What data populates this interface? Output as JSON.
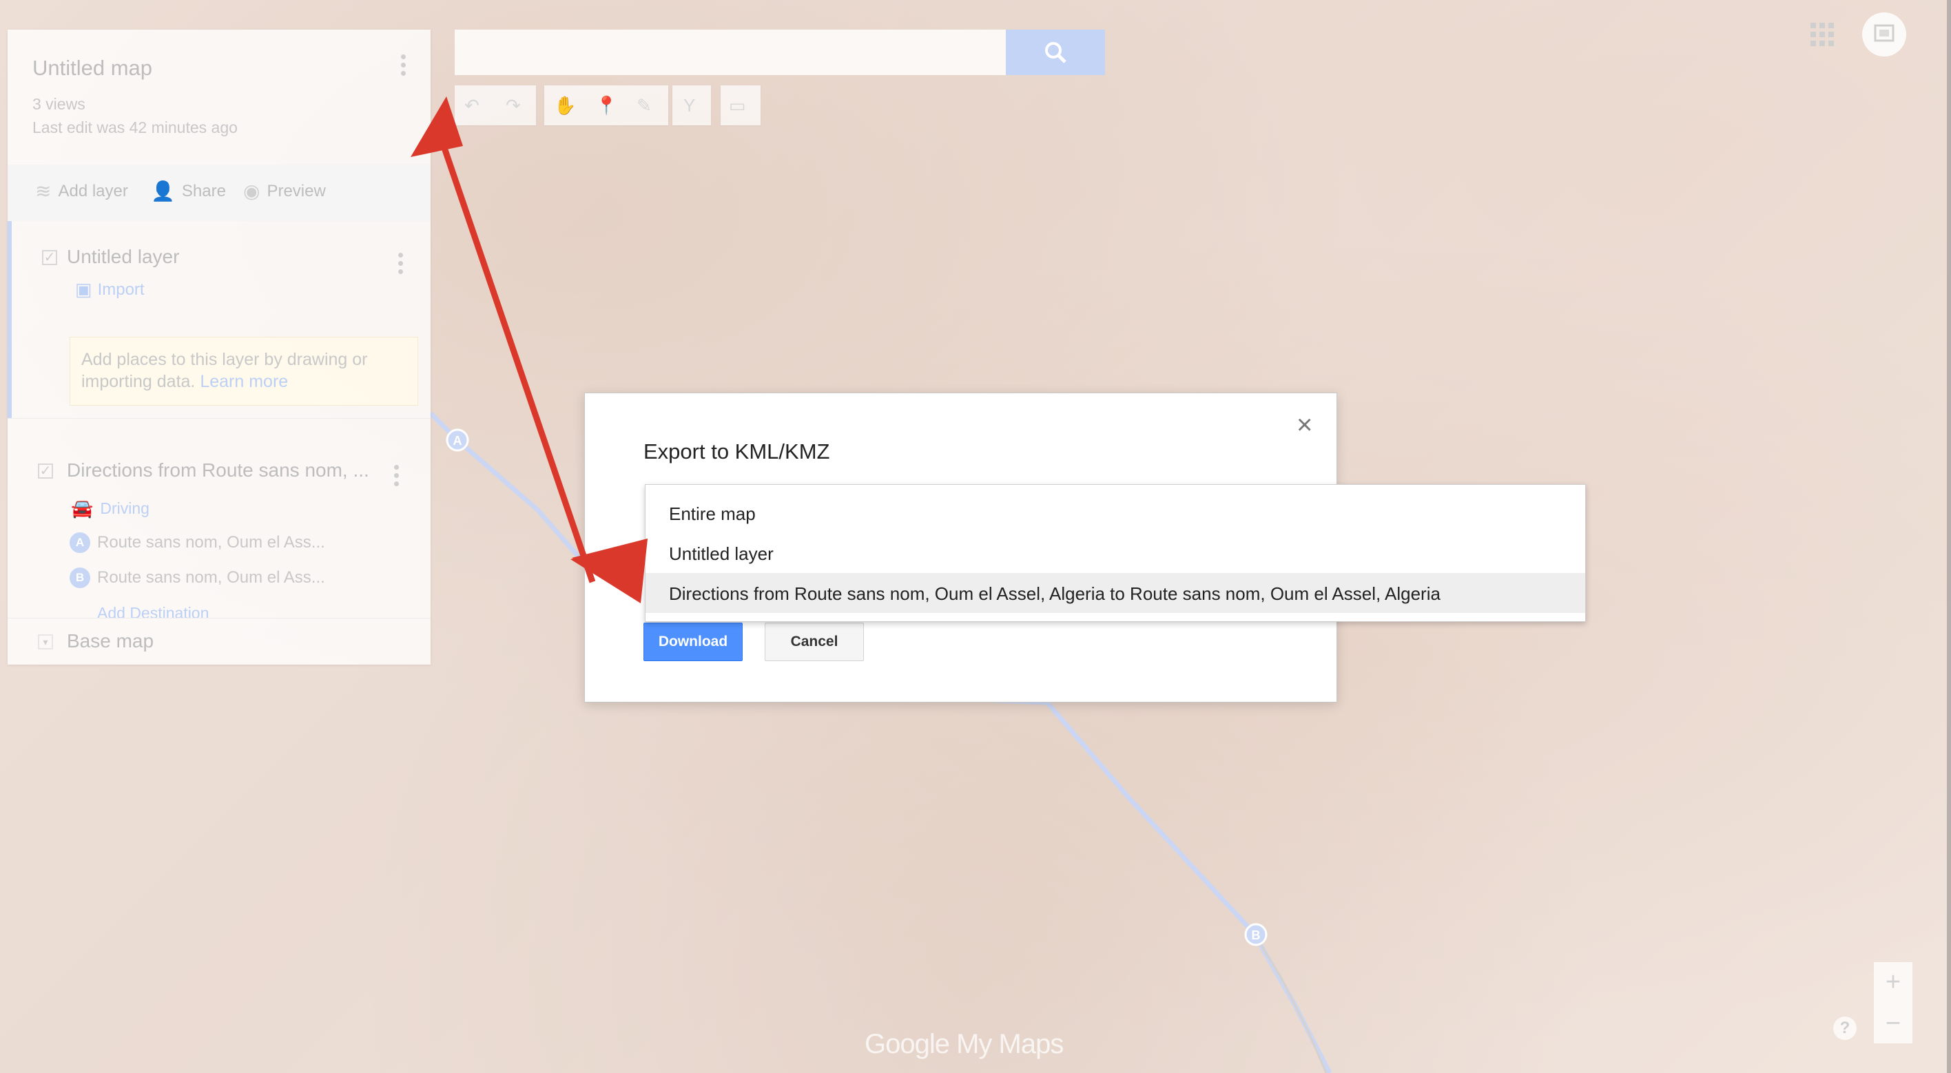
{
  "map": {
    "title": "Untitled map",
    "views": "3 views",
    "last_edit": "Last edit was 42 minutes ago",
    "marker_a": "A",
    "marker_b": "B",
    "brand": "Google My Maps"
  },
  "panel": {
    "actions": {
      "add_layer": "Add layer",
      "share": "Share",
      "preview": "Preview"
    },
    "layer1": {
      "name": "Untitled layer",
      "import": "Import",
      "hint_text": "Add places to this layer by drawing or importing data.",
      "hint_link": "Learn more"
    },
    "layer2": {
      "name": "Directions from Route sans nom, ...",
      "mode": "Driving",
      "stop_a": "Route sans nom, Oum el Ass...",
      "stop_b": "Route sans nom, Oum el Ass...",
      "add_destination": "Add Destination"
    },
    "base_map": "Base map"
  },
  "toolbar": {
    "icons": [
      "undo-icon",
      "redo-icon",
      "hand-icon",
      "marker-icon",
      "draw-line-icon",
      "directions-icon",
      "ruler-icon"
    ]
  },
  "dialog": {
    "title": "Export to KML/KMZ",
    "close": "×",
    "download": "Download",
    "cancel": "Cancel",
    "options": [
      "Entire map",
      "Untitled layer",
      "Directions from Route sans nom, Oum el Assel, Algeria to Route sans nom, Oum el Assel, Algeria"
    ],
    "selected_index": 2
  },
  "zoom": {
    "in": "+",
    "out": "−"
  },
  "help": "?",
  "colors": {
    "accent_blue": "#4d90fe",
    "annotation_red": "#d9382a"
  }
}
